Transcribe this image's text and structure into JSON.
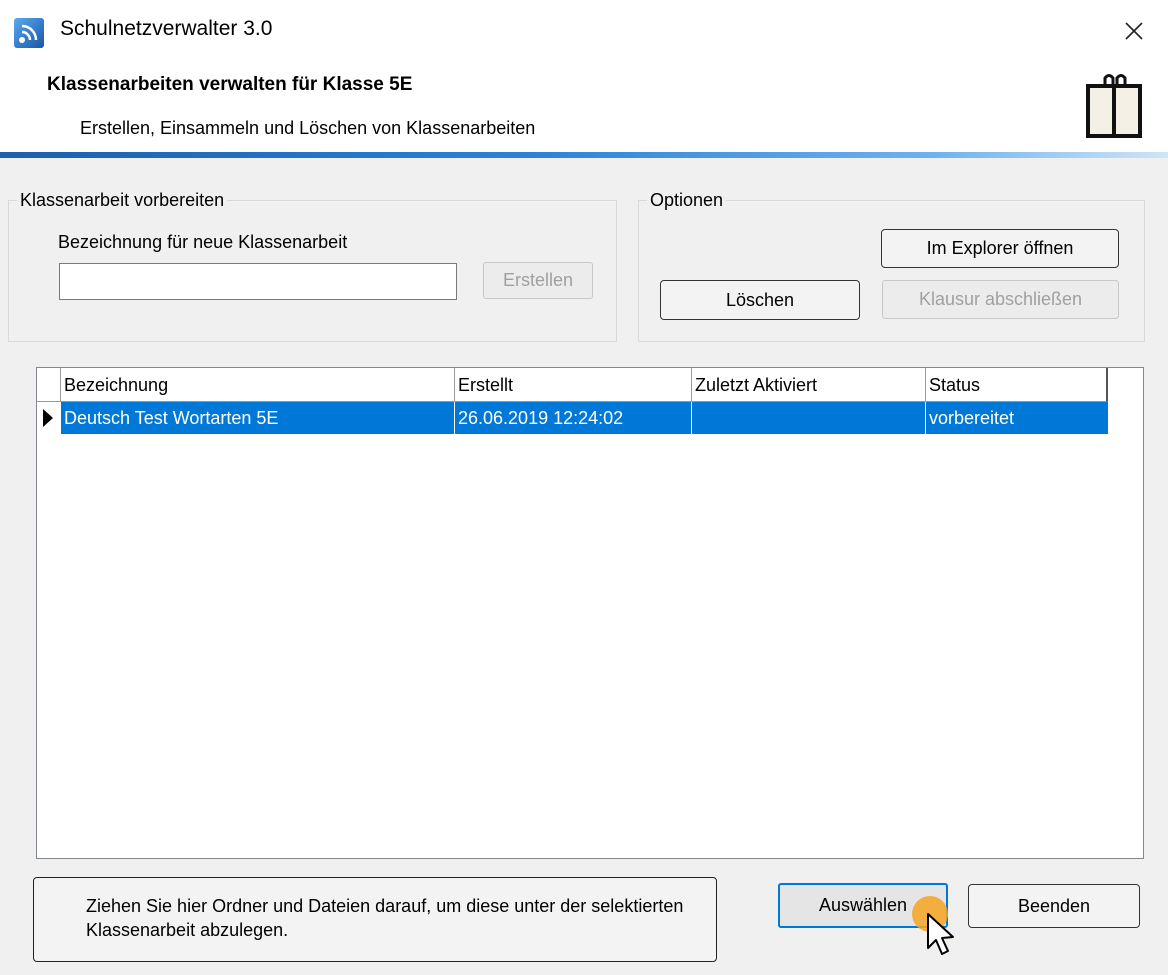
{
  "window": {
    "title": "Schulnetzverwalter 3.0",
    "app_icon": "app-network-icon",
    "close_icon": "close-icon"
  },
  "header": {
    "title": "Klassenarbeiten verwalten für Klasse 5E",
    "subtitle": "Erstellen, Einsammeln und Löschen von Klassenarbeiten",
    "icon": "book-icon",
    "accent": "#1c5fae"
  },
  "prepare": {
    "legend": "Klassenarbeit vorbereiten",
    "name_label": "Bezeichnung für neue Klassenarbeit",
    "name_value": "",
    "create_label": "Erstellen"
  },
  "options": {
    "legend": "Optionen",
    "explorer_label": "Im Explorer öffnen",
    "delete_label": "Löschen",
    "finalize_label": "Klausur abschließen"
  },
  "list": {
    "columns": [
      "Bezeichnung",
      "Erstellt",
      "Zuletzt Aktiviert",
      "Status"
    ],
    "rows": [
      {
        "name": "Deutsch Test Wortarten 5E",
        "created": "26.06.2019 12:24:02",
        "last_activated": "",
        "status": "vorbereitet",
        "selected": true
      }
    ],
    "selection_color": "#0078d7"
  },
  "footer": {
    "drop_zone_text": "Ziehen Sie hier Ordner und Dateien darauf, um diese unter der selektierten Klassenarbeit abzulegen.",
    "select_label": "Auswählen",
    "exit_label": "Beenden"
  }
}
